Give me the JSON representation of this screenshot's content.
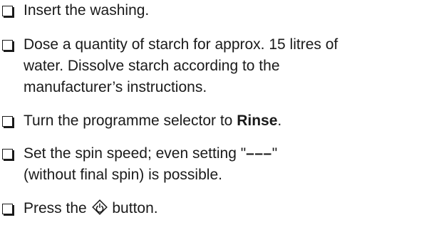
{
  "items": [
    {
      "lines": [
        "Insert the washing."
      ]
    },
    {
      "lines": [
        "Dose a quantity of starch for approx. 15 litres of",
        "water. Dissolve starch according to the",
        "manufacturer’s instructions."
      ]
    },
    {
      "prefix": "Turn the programme selector to ",
      "bold": "Rinse",
      "suffix": "."
    },
    {
      "line1_prefix": "Set the spin speed; even setting \"",
      "line1_dashes": "–––",
      "line1_suffix": "\"",
      "line2": "(without final spin) is possible."
    },
    {
      "prefix": "Press the ",
      "icon": "start-pause-icon",
      "suffix": " button."
    }
  ]
}
